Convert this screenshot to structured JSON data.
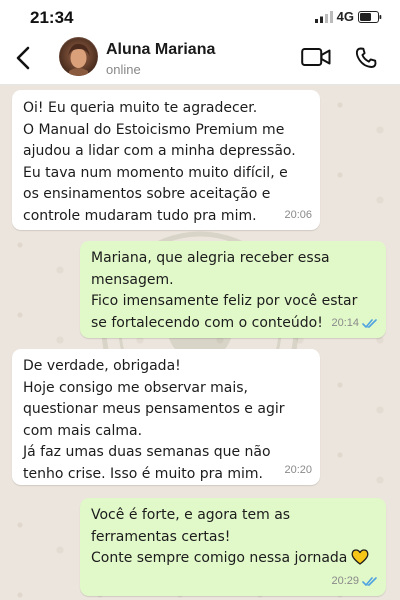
{
  "status_bar": {
    "time": "21:34",
    "network": "4G"
  },
  "header": {
    "contact_name": "Aluna Mariana",
    "contact_status": "online"
  },
  "messages": [
    {
      "direction": "incoming",
      "text": "Oi! Eu queria muito te agradecer.\nO Manual do Estoicismo Premium me ajudou a lidar com a minha depressão.\nEu tava num momento muito difícil, e os ensinamentos sobre aceitação e controle mudaram tudo pra mim.",
      "time": "20:06"
    },
    {
      "direction": "outgoing",
      "text": "Mariana, que alegria receber essa mensagem.\nFico imensamente feliz por você estar se fortalecendo com o conteúdo!",
      "time": "20:14",
      "status": "read"
    },
    {
      "direction": "incoming",
      "text": "De verdade, obrigada!\nHoje consigo me observar mais, questionar meus pensamentos e agir com mais calma.\nJá faz umas duas semanas que não tenho crise. Isso é muito pra mim.",
      "time": "20:20"
    },
    {
      "direction": "outgoing",
      "text": "Você é forte, e agora tem as ferramentas certas!\nConte sempre comigo nessa jornada",
      "emoji": "yellow-heart",
      "time": "20:29",
      "status": "read"
    }
  ],
  "colors": {
    "chat_background": "#ece5dd",
    "incoming_bubble": "#ffffff",
    "outgoing_bubble": "#e1f8c9",
    "read_check": "#4fa3e0",
    "heart": "#f5c518"
  }
}
